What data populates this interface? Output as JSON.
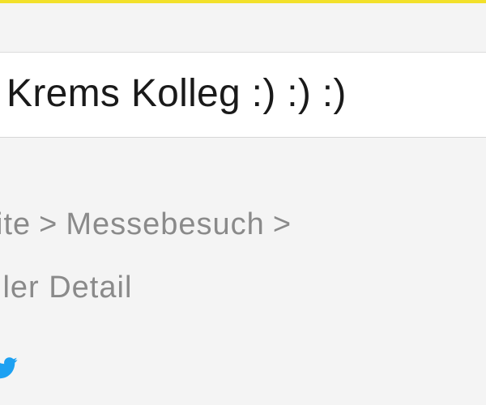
{
  "title": "Krems Kolleg :) :) :)",
  "breadcrumb": {
    "items": [
      "ite",
      "Messebesuch",
      "ller Detail"
    ],
    "separator": ">"
  },
  "social": {
    "icon": "twitter-icon",
    "color": "#1da1f2"
  },
  "colors": {
    "accent": "#f2e02a",
    "background": "#f4f4f4",
    "breadcrumb_text": "#8a8a8a"
  }
}
